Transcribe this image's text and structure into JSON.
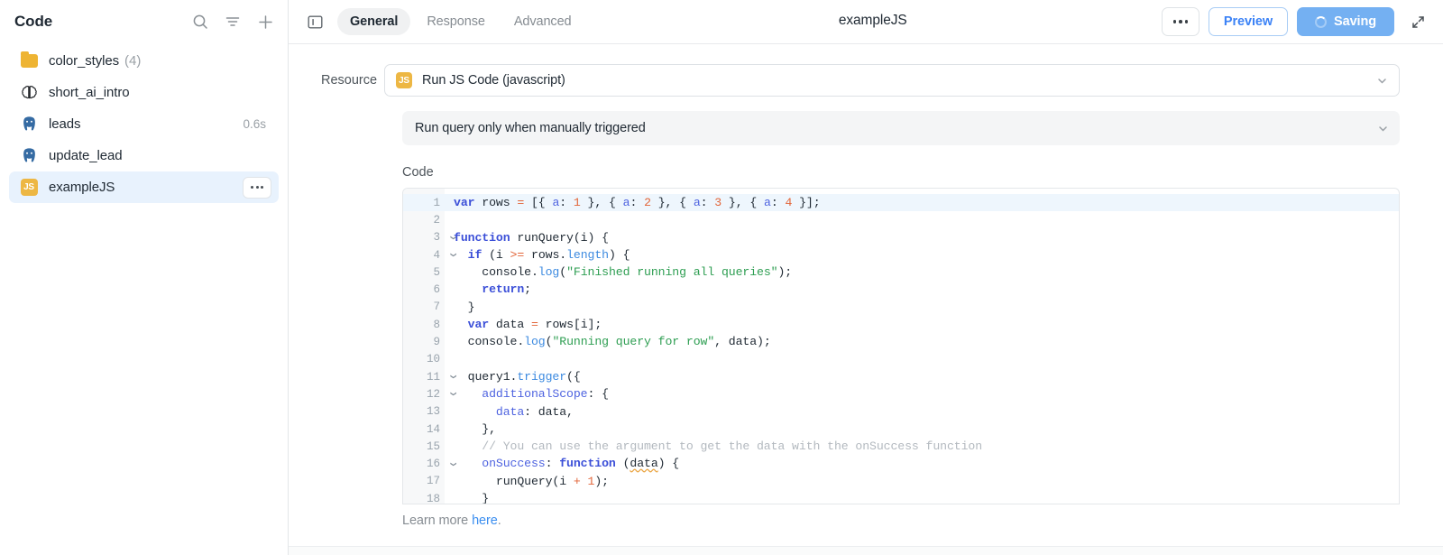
{
  "sidebar": {
    "title": "Code",
    "actions": [
      {
        "name": "search-icon",
        "label": "Search"
      },
      {
        "name": "filter-icon",
        "label": "Filter"
      },
      {
        "name": "add-icon",
        "label": "Add"
      }
    ],
    "items": [
      {
        "icon": "folder-icon",
        "label": "color_styles",
        "count": "(4)",
        "time": "",
        "selected": false
      },
      {
        "icon": "brain-icon",
        "label": "short_ai_intro",
        "count": "",
        "time": "",
        "selected": false
      },
      {
        "icon": "postgres-icon",
        "label": "leads",
        "count": "",
        "time": "0.6s",
        "selected": false
      },
      {
        "icon": "postgres-icon",
        "label": "update_lead",
        "count": "",
        "time": "",
        "selected": false
      },
      {
        "icon": "js-icon",
        "label": "exampleJS",
        "count": "",
        "time": "",
        "selected": true,
        "badge": "JS"
      }
    ]
  },
  "topbar": {
    "panel_toggle": "panel-toggle-icon",
    "tabs": [
      {
        "label": "General",
        "active": true
      },
      {
        "label": "Response",
        "active": false
      },
      {
        "label": "Advanced",
        "active": false
      }
    ],
    "doc_title": "exampleJS",
    "more_label": "•••",
    "preview_label": "Preview",
    "saving_label": "Saving",
    "expand_label": "Expand"
  },
  "form": {
    "resource_label": "Resource",
    "resource_value": "Run JS Code (javascript)",
    "resource_badge": "JS",
    "trigger_value": "Run query only when manually triggered",
    "code_label": "Code"
  },
  "footer": {
    "learn_prefix": "Learn more ",
    "learn_link": "here",
    "learn_suffix": "."
  },
  "colors": {
    "accent": "#3b82f6",
    "saving_bg": "#74b0f2",
    "selected_row": "#e8f2fd",
    "active_line": "#eef6fd",
    "js_badge": "#edb744",
    "folder": "#eeb433"
  },
  "code": {
    "lines": [
      {
        "n": 1,
        "fold": false,
        "highlight": true,
        "tokens": [
          {
            "t": "var",
            "c": "kw"
          },
          {
            "t": " rows ",
            "c": ""
          },
          {
            "t": "=",
            "c": "op"
          },
          {
            "t": " [{ ",
            "c": ""
          },
          {
            "t": "a",
            "c": "prop"
          },
          {
            "t": ": ",
            "c": ""
          },
          {
            "t": "1",
            "c": "num"
          },
          {
            "t": " }, { ",
            "c": ""
          },
          {
            "t": "a",
            "c": "prop"
          },
          {
            "t": ": ",
            "c": ""
          },
          {
            "t": "2",
            "c": "num"
          },
          {
            "t": " }, { ",
            "c": ""
          },
          {
            "t": "a",
            "c": "prop"
          },
          {
            "t": ": ",
            "c": ""
          },
          {
            "t": "3",
            "c": "num"
          },
          {
            "t": " }, { ",
            "c": ""
          },
          {
            "t": "a",
            "c": "prop"
          },
          {
            "t": ": ",
            "c": ""
          },
          {
            "t": "4",
            "c": "num"
          },
          {
            "t": " }];",
            "c": ""
          }
        ]
      },
      {
        "n": 2,
        "fold": false,
        "highlight": false,
        "tokens": []
      },
      {
        "n": 3,
        "fold": true,
        "highlight": false,
        "tokens": [
          {
            "t": "function",
            "c": "kw"
          },
          {
            "t": " runQuery(i) {",
            "c": ""
          }
        ]
      },
      {
        "n": 4,
        "fold": true,
        "highlight": false,
        "tokens": [
          {
            "t": "  ",
            "c": ""
          },
          {
            "t": "if",
            "c": "kw"
          },
          {
            "t": " (i ",
            "c": ""
          },
          {
            "t": ">=",
            "c": "op"
          },
          {
            "t": " rows",
            "c": ""
          },
          {
            "t": ".",
            "c": ""
          },
          {
            "t": "length",
            "c": "fn"
          },
          {
            "t": ") {",
            "c": ""
          }
        ]
      },
      {
        "n": 5,
        "fold": false,
        "highlight": false,
        "tokens": [
          {
            "t": "    console",
            "c": ""
          },
          {
            "t": ".",
            "c": ""
          },
          {
            "t": "log",
            "c": "fn"
          },
          {
            "t": "(",
            "c": ""
          },
          {
            "t": "\"Finished running all queries\"",
            "c": "str"
          },
          {
            "t": ");",
            "c": ""
          }
        ]
      },
      {
        "n": 6,
        "fold": false,
        "highlight": false,
        "tokens": [
          {
            "t": "    ",
            "c": ""
          },
          {
            "t": "return",
            "c": "kw"
          },
          {
            "t": ";",
            "c": ""
          }
        ]
      },
      {
        "n": 7,
        "fold": false,
        "highlight": false,
        "tokens": [
          {
            "t": "  }",
            "c": ""
          }
        ]
      },
      {
        "n": 8,
        "fold": false,
        "highlight": false,
        "tokens": [
          {
            "t": "  ",
            "c": ""
          },
          {
            "t": "var",
            "c": "kw"
          },
          {
            "t": " data ",
            "c": ""
          },
          {
            "t": "=",
            "c": "op"
          },
          {
            "t": " rows[i];",
            "c": ""
          }
        ]
      },
      {
        "n": 9,
        "fold": false,
        "highlight": false,
        "tokens": [
          {
            "t": "  console",
            "c": ""
          },
          {
            "t": ".",
            "c": ""
          },
          {
            "t": "log",
            "c": "fn"
          },
          {
            "t": "(",
            "c": ""
          },
          {
            "t": "\"Running query for row\"",
            "c": "str"
          },
          {
            "t": ", data);",
            "c": ""
          }
        ]
      },
      {
        "n": 10,
        "fold": false,
        "highlight": false,
        "tokens": []
      },
      {
        "n": 11,
        "fold": true,
        "highlight": false,
        "tokens": [
          {
            "t": "  query1",
            "c": ""
          },
          {
            "t": ".",
            "c": ""
          },
          {
            "t": "trigger",
            "c": "fn"
          },
          {
            "t": "({",
            "c": ""
          }
        ]
      },
      {
        "n": 12,
        "fold": true,
        "highlight": false,
        "tokens": [
          {
            "t": "    ",
            "c": ""
          },
          {
            "t": "additionalScope",
            "c": "prop"
          },
          {
            "t": ": {",
            "c": ""
          }
        ]
      },
      {
        "n": 13,
        "fold": false,
        "highlight": false,
        "tokens": [
          {
            "t": "      ",
            "c": ""
          },
          {
            "t": "data",
            "c": "prop"
          },
          {
            "t": ": data,",
            "c": ""
          }
        ]
      },
      {
        "n": 14,
        "fold": false,
        "highlight": false,
        "tokens": [
          {
            "t": "    },",
            "c": ""
          }
        ]
      },
      {
        "n": 15,
        "fold": false,
        "highlight": false,
        "tokens": [
          {
            "t": "    // You can use the argument to get the data with the onSuccess function",
            "c": "cmt"
          }
        ]
      },
      {
        "n": 16,
        "fold": true,
        "highlight": false,
        "tokens": [
          {
            "t": "    ",
            "c": ""
          },
          {
            "t": "onSuccess",
            "c": "prop"
          },
          {
            "t": ": ",
            "c": ""
          },
          {
            "t": "function",
            "c": "kw"
          },
          {
            "t": " (",
            "c": ""
          },
          {
            "t": "data",
            "c": "squig"
          },
          {
            "t": ") {",
            "c": ""
          }
        ]
      },
      {
        "n": 17,
        "fold": false,
        "highlight": false,
        "tokens": [
          {
            "t": "      runQuery(i ",
            "c": ""
          },
          {
            "t": "+",
            "c": "op"
          },
          {
            "t": " ",
            "c": ""
          },
          {
            "t": "1",
            "c": "num"
          },
          {
            "t": ");",
            "c": ""
          }
        ]
      },
      {
        "n": 18,
        "fold": false,
        "highlight": false,
        "tokens": [
          {
            "t": "    }",
            "c": ""
          }
        ]
      }
    ]
  }
}
